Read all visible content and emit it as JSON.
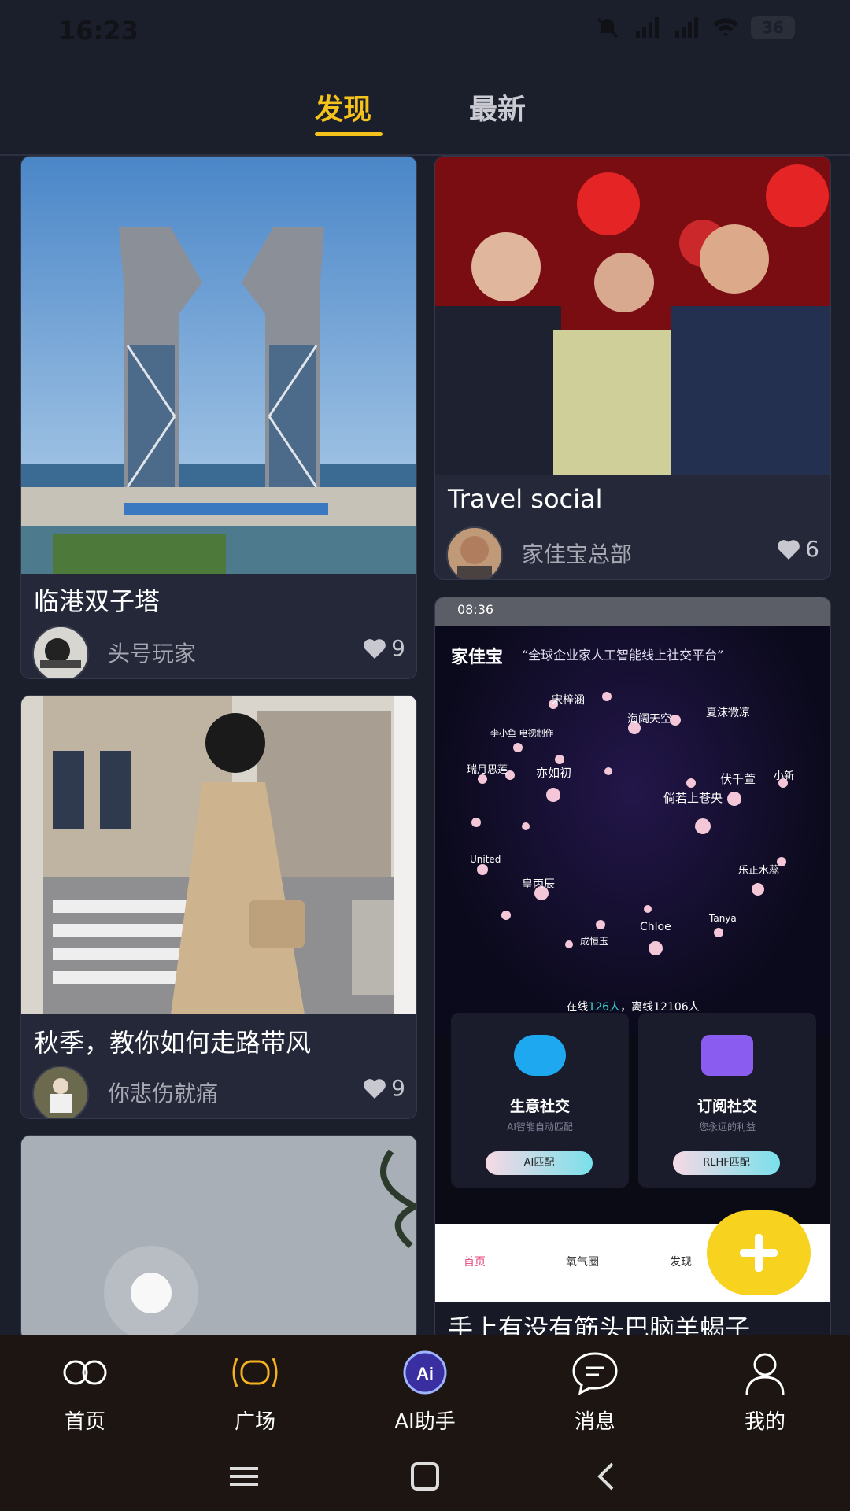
{
  "status_bar": {
    "time": "16:23",
    "network_1": "5G",
    "network_2": "5G",
    "battery": "36"
  },
  "top_tabs": {
    "discover": "发现",
    "latest": "最新"
  },
  "feed": {
    "card_1": {
      "title": "临港双子塔",
      "author": "头号玩家",
      "likes": "9"
    },
    "card_2": {
      "title": "秋季，教你如何走路带风",
      "author": "你悲伤就痛",
      "likes": "9"
    },
    "card_3": {
      "title": "Travel social",
      "author": "家佳宝总部",
      "likes": "6"
    },
    "card_4": {
      "title": "手上有没有筋头巴脑羊蝎子",
      "screenshot": {
        "time": "08:36",
        "brand": "家佳宝",
        "slogan": "“全球企业家人工智能线上社交平台”",
        "online_text_prefix": "在线",
        "online_count": "126人",
        "online_text_suffix": "，离线12106人",
        "names": [
          "宋梓涵",
          "海阔天空",
          "夏沫微凉",
          "李小鱼 电视制作",
          "瑞月思莲",
          "亦如初",
          "伏千萱",
          "倘若上苍央",
          "小新",
          "United",
          "皇丙辰",
          "乐正水蕊",
          "Chloe",
          "Tanya",
          "成恒玉"
        ],
        "feature_1": {
          "title": "生意社交",
          "subtitle": "AI智能自动匹配",
          "button": "AI匹配"
        },
        "feature_2": {
          "title": "订阅社交",
          "subtitle": "您永远的利益",
          "button": "RLHF匹配"
        },
        "nav": [
          "首页",
          "氧气圈",
          "发现"
        ]
      }
    }
  },
  "bottom_nav": {
    "home": "首页",
    "square": "广场",
    "ai": "AI助手",
    "messages": "消息",
    "mine": "我的"
  },
  "colors": {
    "accent": "#f4c21a",
    "background": "#1b1f2c",
    "card": "#242838",
    "fab": "#f7d21e"
  }
}
